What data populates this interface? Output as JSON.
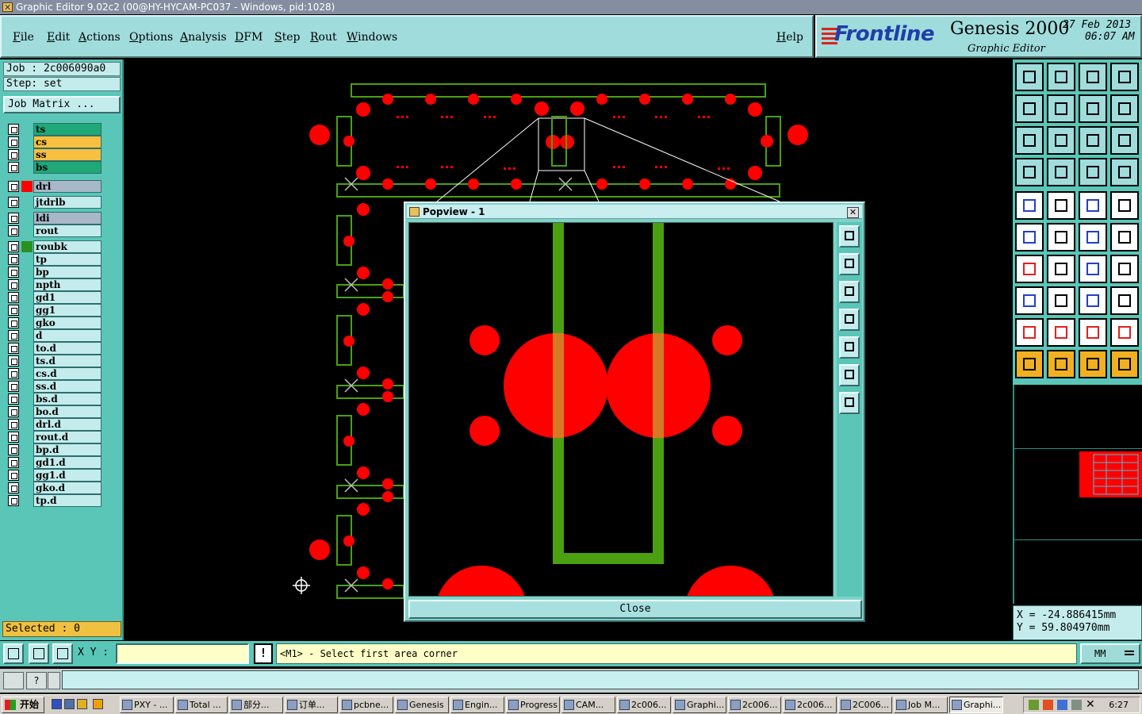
{
  "window": {
    "title": "Graphic Editor 9.02c2 (00@HY-HYCAM-PC037 - Windows, pid:1028)"
  },
  "menu": {
    "items": [
      "File",
      "Edit",
      "Actions",
      "Options",
      "Analysis",
      "DFM",
      "Step",
      "Rout",
      "Windows"
    ],
    "help": "Help"
  },
  "brand": {
    "logo": "Frontline",
    "product": "Genesis 2000",
    "subtitle": "Graphic Editor",
    "date": "27 Feb 2013",
    "time": "06:07 AM"
  },
  "job": {
    "job": "Job : 2c006090a0",
    "step": "Step: set",
    "matrix_button": "Job Matrix ..."
  },
  "layers": [
    {
      "name": "ts",
      "color": "#20a878"
    },
    {
      "name": "cs",
      "color": "#f8c040"
    },
    {
      "name": "ss",
      "color": "#f8c040"
    },
    {
      "name": "bs",
      "color": "#20a878"
    },
    {
      "name": "drl",
      "color": "#a8b8c8",
      "swatch": "#ff0000",
      "gap": true
    },
    {
      "name": "jtdrlb",
      "color": "#c4ecec",
      "gap": true
    },
    {
      "name": "ldi",
      "color": "#a8b8c8",
      "gap": true
    },
    {
      "name": "rout",
      "color": "#c4ecec"
    },
    {
      "name": "roubk",
      "color": "#c4ecec",
      "swatch": "#2a9020",
      "gap": true
    },
    {
      "name": "tp",
      "color": "#c4ecec"
    },
    {
      "name": "bp",
      "color": "#c4ecec"
    },
    {
      "name": "npth",
      "color": "#c4ecec"
    },
    {
      "name": "gd1",
      "color": "#c4ecec"
    },
    {
      "name": "gg1",
      "color": "#c4ecec"
    },
    {
      "name": "gko",
      "color": "#c4ecec"
    },
    {
      "name": "d",
      "color": "#c4ecec"
    },
    {
      "name": "to.d",
      "color": "#c4ecec"
    },
    {
      "name": "ts.d",
      "color": "#c4ecec"
    },
    {
      "name": "cs.d",
      "color": "#c4ecec"
    },
    {
      "name": "ss.d",
      "color": "#c4ecec"
    },
    {
      "name": "bs.d",
      "color": "#c4ecec"
    },
    {
      "name": "bo.d",
      "color": "#c4ecec"
    },
    {
      "name": "drl.d",
      "color": "#c4ecec"
    },
    {
      "name": "rout.d",
      "color": "#c4ecec"
    },
    {
      "name": "bp.d",
      "color": "#c4ecec"
    },
    {
      "name": "gd1.d",
      "color": "#c4ecec"
    },
    {
      "name": "gg1.d",
      "color": "#c4ecec"
    },
    {
      "name": "gko.d",
      "color": "#c4ecec"
    },
    {
      "name": "tp.d",
      "color": "#c4ecec"
    }
  ],
  "selected": "Selected : 0",
  "popview": {
    "title": "Popview - 1",
    "close_label": "Close",
    "close_x": "✕"
  },
  "coords": {
    "x": "X = -24.886415mm",
    "y": "Y = 59.804970mm"
  },
  "status": {
    "xy_label": "X Y :",
    "xy_value": "",
    "bang": "!",
    "prompt": "<M1> - Select first area corner",
    "units": "MM"
  },
  "msgrow": {
    "help_btn": "?"
  },
  "taskbar": {
    "start": "开始",
    "tasks": [
      "PXY - ...",
      "Total ...",
      "部分...",
      "订单...",
      "pcbne...",
      "Genesis",
      "Engin...",
      "Progress",
      "CAM...",
      "2c006...",
      "Graphi...",
      "2c006...",
      "2c006...",
      "2C006...",
      "Job M...",
      "Graphi..."
    ],
    "clock": "6:27"
  },
  "colors": {
    "pad": "#ff0000",
    "trace": "#4aa010",
    "panel": "#59c6b8",
    "light": "#c4ecec"
  }
}
